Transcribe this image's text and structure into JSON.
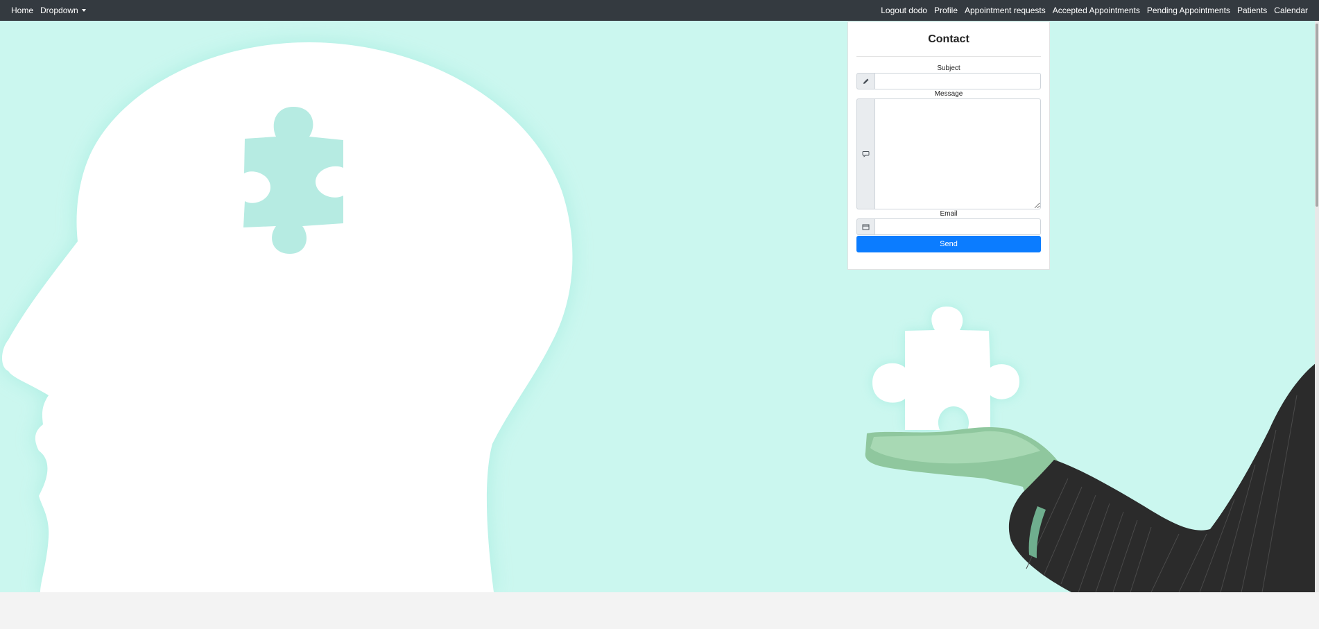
{
  "navbar": {
    "left_items": [
      {
        "label": "Home"
      },
      {
        "label": "Dropdown"
      }
    ],
    "right_items": [
      {
        "label": "Logout dodo"
      },
      {
        "label": "Profile"
      },
      {
        "label": "Appointment requests"
      },
      {
        "label": "Accepted Appointments"
      },
      {
        "label": "Pending Appointments"
      },
      {
        "label": "Patients"
      },
      {
        "label": "Calendar"
      }
    ],
    "background": "#343a40"
  },
  "contact_form": {
    "title": "Contact",
    "subject": {
      "label": "Subject",
      "value": "",
      "icon": "pencil-icon"
    },
    "message": {
      "label": "Message",
      "value": "",
      "icon": "chat-bubble-icon"
    },
    "email": {
      "label": "Email",
      "value": "",
      "icon": "envelope-icon"
    },
    "send_label": "Send"
  },
  "hero": {
    "illustration": "head silhouette with puzzle piece and hand holding puzzle piece",
    "background": "#cbf7ef"
  },
  "colors": {
    "accent": "#0b7cff"
  }
}
